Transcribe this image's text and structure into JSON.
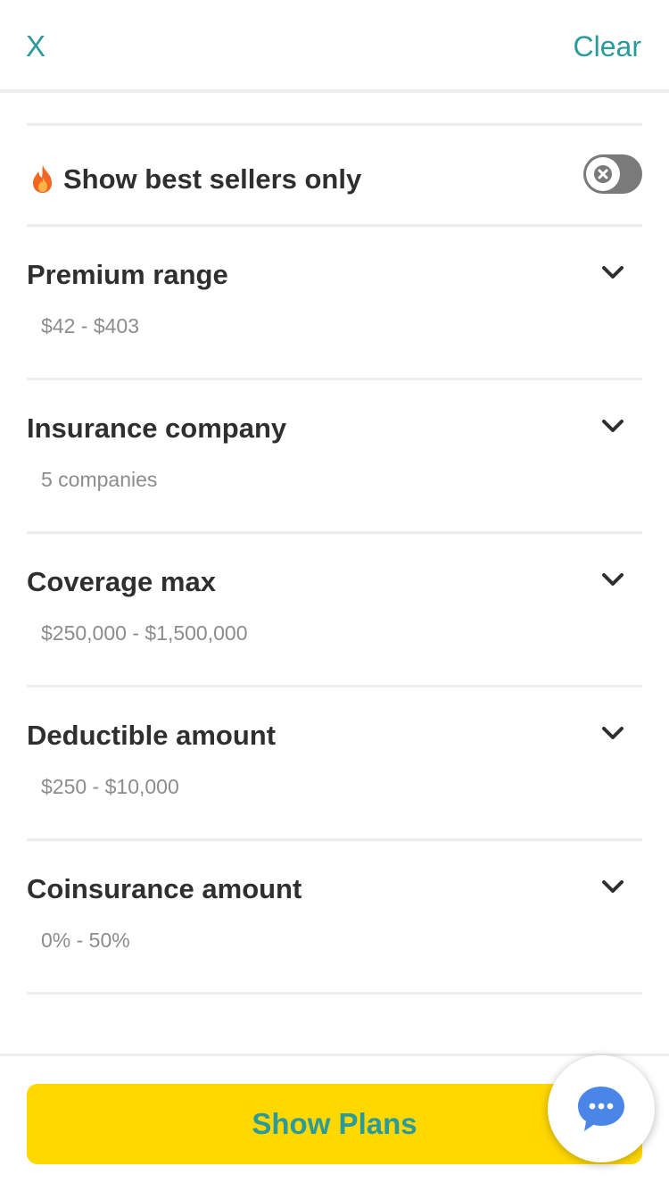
{
  "header": {
    "close_label": "X",
    "clear_label": "Clear"
  },
  "best_sellers": {
    "icon": "fire-icon",
    "label": "Show best sellers only",
    "enabled": false
  },
  "filters": [
    {
      "title": "Premium range",
      "value": "$42 - $403"
    },
    {
      "title": "Insurance company",
      "value": "5 companies"
    },
    {
      "title": "Coverage max",
      "value": "$250,000 - $1,500,000"
    },
    {
      "title": "Deductible amount",
      "value": "$250 - $10,000"
    },
    {
      "title": "Coinsurance amount",
      "value": "0% - 50%"
    }
  ],
  "footer": {
    "show_plans_label": "Show Plans"
  },
  "chat": {
    "icon": "chat-bubble-icon"
  },
  "colors": {
    "accent": "#2b9a9a",
    "button_bg": "#ffd800",
    "toggle_off": "#7a7a7a",
    "chat_blue": "#4a86e8",
    "fire": "#f26522"
  }
}
